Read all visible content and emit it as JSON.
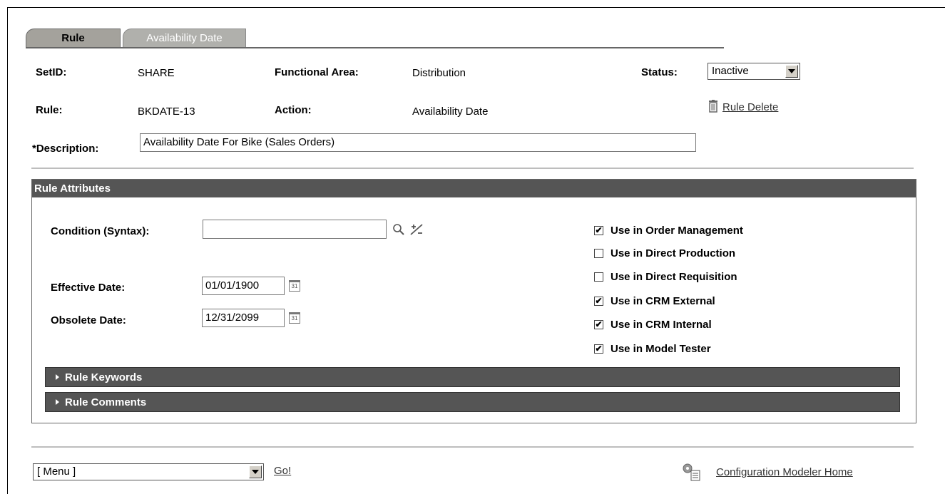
{
  "tabs": [
    {
      "label": "Rule",
      "active": true
    },
    {
      "label": "Availability Date",
      "active": false
    }
  ],
  "header": {
    "setid_label": "SetID:",
    "setid_value": "SHARE",
    "functional_area_label": "Functional Area:",
    "functional_area_value": "Distribution",
    "status_label": "Status:",
    "status_value": "Inactive",
    "rule_label": "Rule:",
    "rule_value": "BKDATE-13",
    "action_label": "Action:",
    "action_value": "Availability Date",
    "rule_delete_label": "Rule Delete",
    "description_label": "*Description:",
    "description_value": "Availability Date For Bike (Sales Orders)"
  },
  "rule_attributes": {
    "title": "Rule Attributes",
    "condition_label": "Condition (Syntax):",
    "condition_value": "",
    "effective_date_label": "Effective Date:",
    "effective_date_value": "01/01/1900",
    "obsolete_date_label": "Obsolete Date:",
    "obsolete_date_value": "12/31/2099",
    "checkboxes": [
      {
        "label": "Use in Order Management",
        "checked": true
      },
      {
        "label": "Use in Direct Production",
        "checked": false
      },
      {
        "label": "Use in Direct Requisition",
        "checked": false
      },
      {
        "label": "Use in CRM External",
        "checked": true
      },
      {
        "label": "Use in CRM Internal",
        "checked": true
      },
      {
        "label": "Use in Model Tester",
        "checked": true
      }
    ],
    "keywords_label": "Rule Keywords",
    "comments_label": "Rule Comments"
  },
  "footer": {
    "menu_value": "[ Menu ]",
    "go_label": "Go!",
    "home_link": "Configuration Modeler Home"
  },
  "icons": {
    "search": "magnifier-icon",
    "edit_syntax": "syntax-icon",
    "calendar": "calendar-icon",
    "trash": "trash-icon",
    "home": "modeler-home-icon"
  }
}
